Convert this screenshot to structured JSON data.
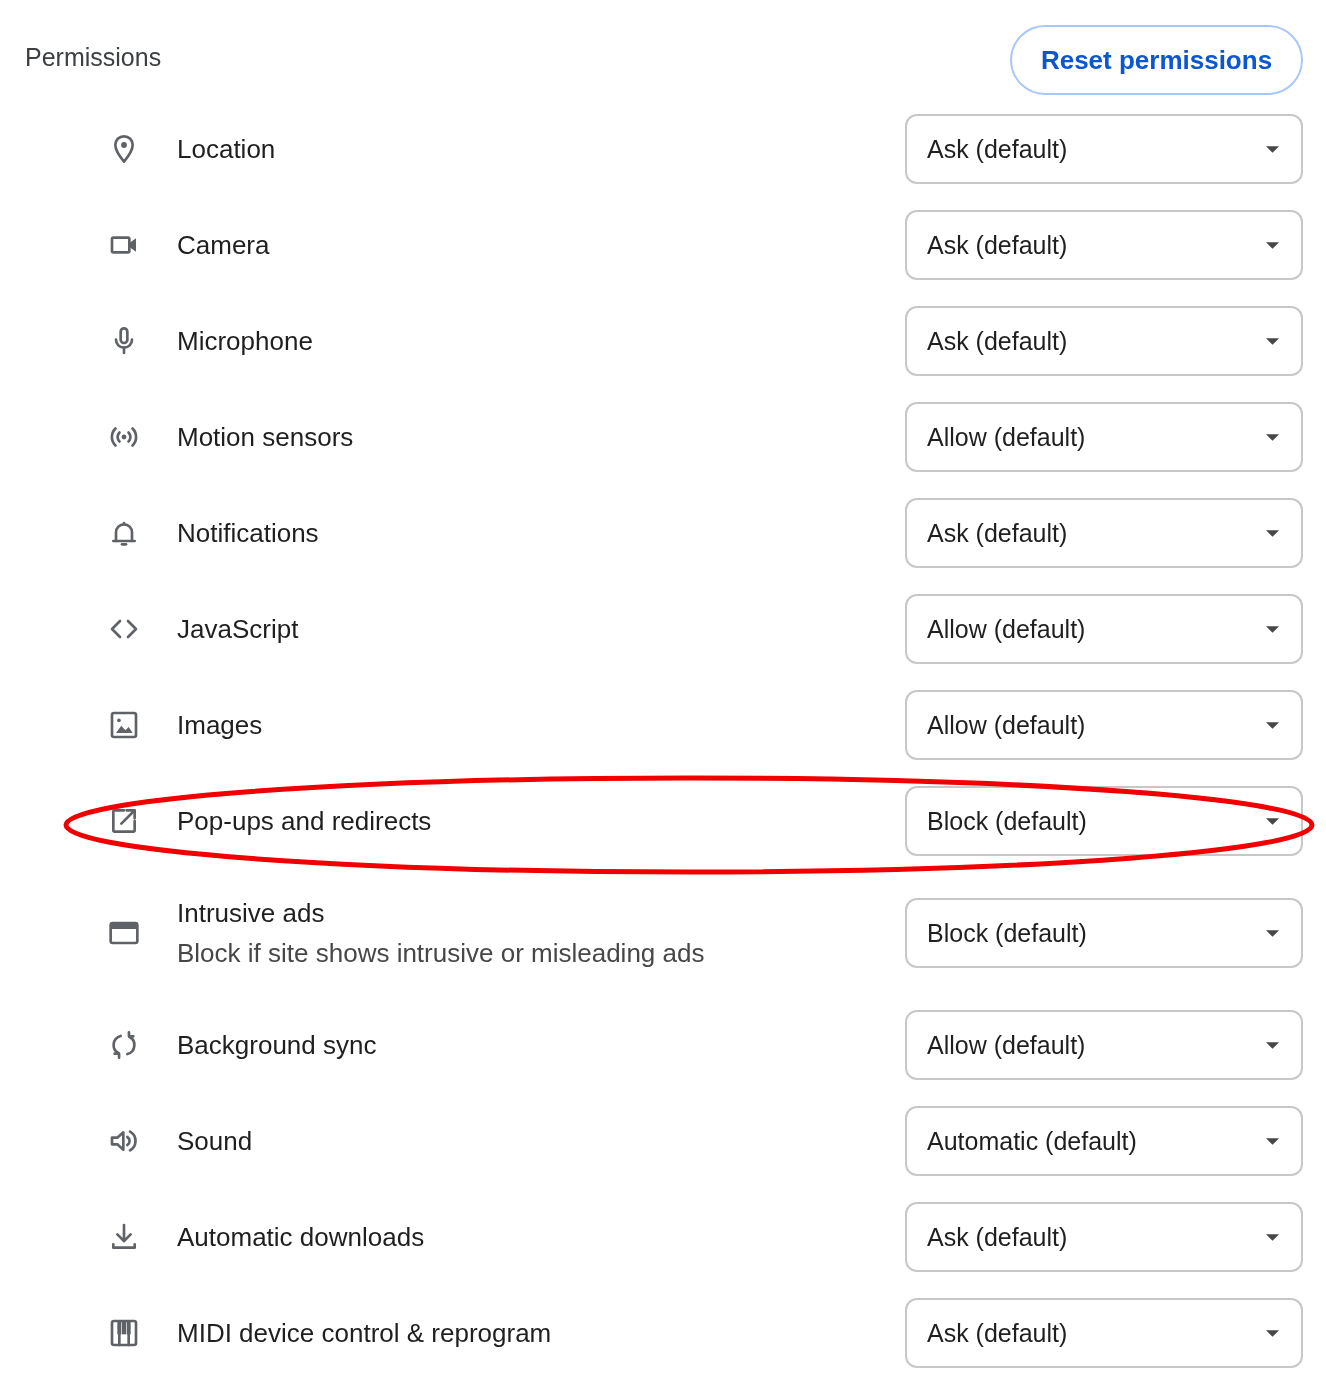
{
  "section": {
    "title": "Permissions"
  },
  "reset_button": {
    "label": "Reset permissions"
  },
  "permissions": [
    {
      "label": "Location",
      "value": "Ask (default)",
      "highlighted": false
    },
    {
      "label": "Camera",
      "value": "Ask (default)",
      "highlighted": false
    },
    {
      "label": "Microphone",
      "value": "Ask (default)",
      "highlighted": false
    },
    {
      "label": "Motion sensors",
      "value": "Allow (default)",
      "highlighted": false
    },
    {
      "label": "Notifications",
      "value": "Ask (default)",
      "highlighted": false
    },
    {
      "label": "JavaScript",
      "value": "Allow (default)",
      "highlighted": false
    },
    {
      "label": "Images",
      "value": "Allow (default)",
      "highlighted": false
    },
    {
      "label": "Pop-ups and redirects",
      "value": "Block (default)",
      "highlighted": true
    },
    {
      "label": "Intrusive ads",
      "description": "Block if site shows intrusive or misleading ads",
      "value": "Block (default)",
      "highlighted": false
    },
    {
      "label": "Background sync",
      "value": "Allow (default)",
      "highlighted": false
    },
    {
      "label": "Sound",
      "value": "Automatic (default)",
      "highlighted": false
    },
    {
      "label": "Automatic downloads",
      "value": "Ask (default)",
      "highlighted": false
    },
    {
      "label": "MIDI device control & reprogram",
      "value": "Ask (default)",
      "highlighted": false
    }
  ]
}
